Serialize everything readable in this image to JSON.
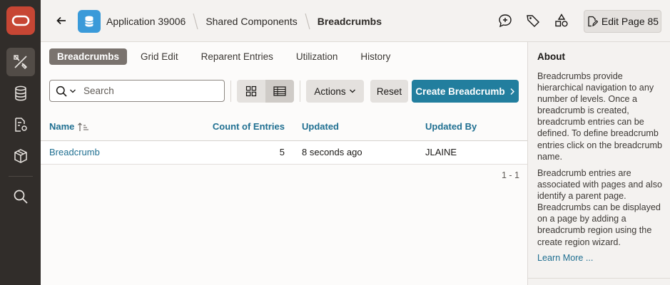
{
  "header": {
    "breadcrumbs": [
      "Application 39006",
      "Shared Components",
      "Breadcrumbs"
    ],
    "edit_button_label": "Edit Page 85"
  },
  "tabs": [
    {
      "label": "Breadcrumbs",
      "active": true
    },
    {
      "label": "Grid Edit",
      "active": false
    },
    {
      "label": "Reparent Entries",
      "active": false
    },
    {
      "label": "Utilization",
      "active": false
    },
    {
      "label": "History",
      "active": false
    }
  ],
  "toolbar": {
    "search_placeholder": "Search",
    "actions_label": "Actions",
    "reset_label": "Reset",
    "create_label": "Create Breadcrumb"
  },
  "grid": {
    "columns": [
      "Name",
      "Count of Entries",
      "Updated",
      "Updated By"
    ],
    "rows": [
      {
        "name": "Breadcrumb",
        "count": "5",
        "updated": "8 seconds ago",
        "updated_by": "JLAINE"
      }
    ],
    "pagination": "1 - 1"
  },
  "side_panel": {
    "title": "About",
    "paragraph1": "Breadcrumbs provide hierarchical navigation to any number of levels. Once a breadcrumb is created, breadcrumb entries can be defined. To define breadcrumb entries click on the breadcrumb name.",
    "paragraph2": "Breadcrumb entries are associated with pages and also identify a parent page. Breadcrumbs can be displayed on a page by adding a breadcrumb region using the create region wizard.",
    "link": "Learn More ..."
  },
  "colors": {
    "nav_bg": "#312d2a",
    "logo": "#c74634",
    "accent": "#227e9e",
    "link": "#1f6f91"
  }
}
